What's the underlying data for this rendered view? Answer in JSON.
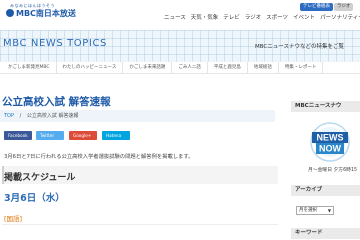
{
  "header": {
    "logo_sub": "みなみにほんほうそう",
    "logo_text": "MBC南日本放送",
    "top_buttons": [
      "テレビ番組表",
      "ラジオ"
    ],
    "nav": [
      "ニュース",
      "天気・気象",
      "テレビ",
      "ラジオ",
      "スポーツ",
      "イベント",
      "パーソナリティー"
    ]
  },
  "hero": {
    "title": "MBC NEWS TOPICS",
    "right_text": "MBCニュースナウなどの特集をご覧"
  },
  "category_nav": [
    "かごしま新発見MBC",
    "わたしのハッピーニュース",
    "かごしま未来話題",
    "ごみ人ニ話",
    "平成と鹿児島",
    "地域総括",
    "特集・レポート"
  ],
  "article": {
    "title": "公立高校入試 解答速報",
    "breadcrumb_top": "TOP",
    "breadcrumb_sep": "/",
    "breadcrumb_current": "公立高校入試 解答速報",
    "share": [
      "Facebook",
      "Twitter",
      "Google+",
      "Hatena"
    ],
    "description": "3月6日と7日に行われる公立高校入学者選抜試験の問題と解答例を掲載します。",
    "schedule_heading": "掲載スケジュール",
    "date_heading": "3月6日（水）",
    "subject": "[国語]"
  },
  "sidebar": {
    "news_heading": "MBCニュースナウ",
    "logo_line1": "NEWS",
    "logo_line2": "NOW",
    "caption": "月～金曜日 夕方6時15",
    "archive_heading": "アーカイブ",
    "archive_select": "月を選択",
    "keyword_heading": "キーワード"
  },
  "colors": {
    "brand_blue": "#1e5aa8",
    "hero_text": "#2b6bb5",
    "subject_orange": "#e07000",
    "facebook": "#3b5998",
    "twitter": "#55acee",
    "googleplus": "#dd4b39",
    "hatena": "#00a4de"
  }
}
